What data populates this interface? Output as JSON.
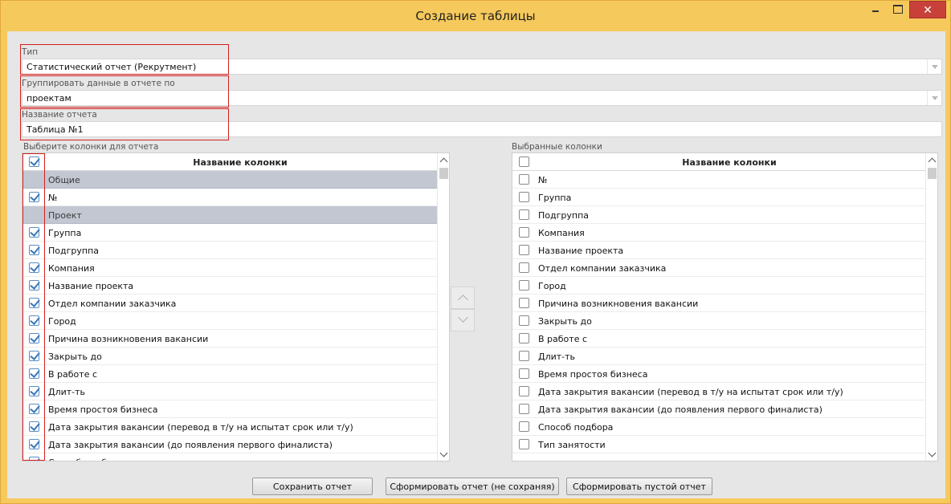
{
  "window": {
    "title": "Создание таблицы",
    "minimize_icon": "minimize-icon",
    "maximize_icon": "maximize-icon",
    "close_icon": "close-icon",
    "close_glyph": "✕",
    "titlebar_color": "#f6c95c",
    "close_color": "#c7413a"
  },
  "form": {
    "type_label": "Тип",
    "type_value": "Статистический отчет (Рекрутмент)",
    "group_label": "Группировать данные в отчете по",
    "group_value": "проектам",
    "name_label": "Название отчета",
    "name_value": "Таблица №1",
    "highlight_color": "#d62020"
  },
  "left_list": {
    "label": "Выберите колонки для отчета",
    "header": "Название колонки",
    "header_checked": true,
    "rows": [
      {
        "label": "Общие",
        "group": true
      },
      {
        "label": "№",
        "checked": true
      },
      {
        "label": "Проект",
        "group": true
      },
      {
        "label": "Группа",
        "checked": true
      },
      {
        "label": "Подгруппа",
        "checked": true
      },
      {
        "label": "Компания",
        "checked": true
      },
      {
        "label": "Название проекта",
        "checked": true
      },
      {
        "label": "Отдел компании заказчика",
        "checked": true
      },
      {
        "label": "Город",
        "checked": true
      },
      {
        "label": "Причина возникновения вакансии",
        "checked": true
      },
      {
        "label": "Закрыть до",
        "checked": true
      },
      {
        "label": "В работе с",
        "checked": true
      },
      {
        "label": "Длит-ть",
        "checked": true
      },
      {
        "label": "Время простоя бизнеса",
        "checked": true
      },
      {
        "label": "Дата закрытия вакансии (перевод в т/у на испытат срок или т/у)",
        "checked": true
      },
      {
        "label": "Дата закрытия вакансии (до появления первого финалиста)",
        "checked": true
      },
      {
        "label": "Способ подбора",
        "checked": true
      }
    ]
  },
  "right_list": {
    "label": "Выбранные колонки",
    "header": "Название колонки",
    "header_checked": false,
    "rows": [
      {
        "label": "№",
        "checked": false
      },
      {
        "label": "Группа",
        "checked": false
      },
      {
        "label": "Подгруппа",
        "checked": false
      },
      {
        "label": "Компания",
        "checked": false
      },
      {
        "label": "Название проекта",
        "checked": false
      },
      {
        "label": "Отдел компании заказчика",
        "checked": false
      },
      {
        "label": "Город",
        "checked": false
      },
      {
        "label": "Причина возникновения вакансии",
        "checked": false
      },
      {
        "label": "Закрыть до",
        "checked": false
      },
      {
        "label": "В работе с",
        "checked": false
      },
      {
        "label": "Длит-ть",
        "checked": false
      },
      {
        "label": "Время простоя бизнеса",
        "checked": false
      },
      {
        "label": "Дата закрытия вакансии (перевод в т/у на испытат срок или т/у)",
        "checked": false
      },
      {
        "label": "Дата закрытия вакансии (до появления первого финалиста)",
        "checked": false
      },
      {
        "label": "Способ подбора",
        "checked": false
      },
      {
        "label": "Тип занятости",
        "checked": false
      }
    ]
  },
  "move_buttons": {
    "up_icon": "chevron-up-icon",
    "down_icon": "chevron-down-icon"
  },
  "buttons": {
    "save": "Сохранить отчет",
    "generate": "Сформировать отчет (не сохраняя)",
    "generate_empty": "Сформировать пустой отчет"
  }
}
